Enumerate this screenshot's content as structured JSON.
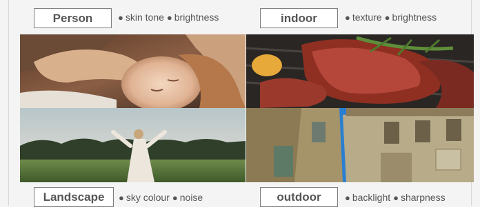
{
  "panels": {
    "person": {
      "tag": "Person",
      "features": [
        "skin tone",
        "brightness"
      ],
      "bullet": "●",
      "photo_icon": "sleeping-child-photo"
    },
    "indoor": {
      "tag": "indoor",
      "features": [
        "texture",
        "brightness"
      ],
      "bullet": "●",
      "photo_icon": "grilled-steak-photo"
    },
    "landscape": {
      "tag": "Landscape",
      "features": [
        "sky colour",
        "noise"
      ],
      "bullet": "●",
      "photo_icon": "woman-in-field-photo"
    },
    "outdoor": {
      "tag": "outdoor",
      "features": [
        "backlight",
        "sharpness"
      ],
      "bullet": "●",
      "photo_icon": "old-buildings-photo"
    }
  }
}
